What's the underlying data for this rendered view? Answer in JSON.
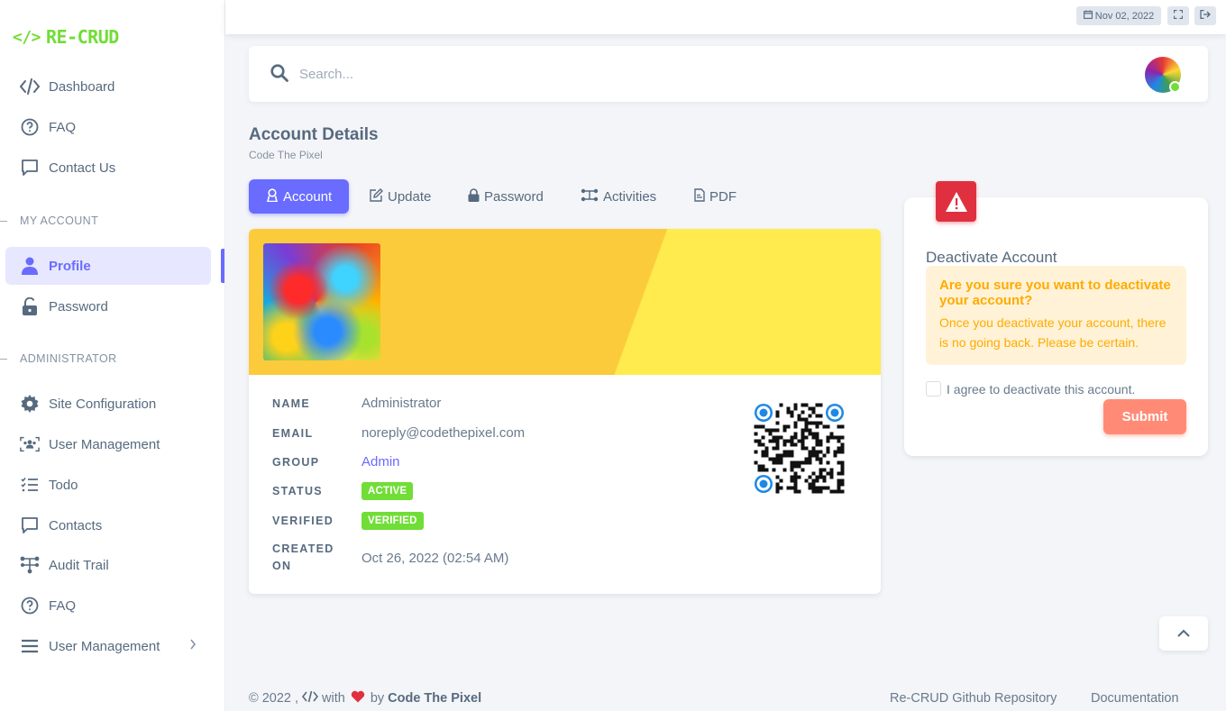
{
  "brand": {
    "name": "RE-CRUD",
    "logo_icon": "code-icon",
    "color": "#71dd37"
  },
  "sidebar": {
    "items_top": [
      {
        "label": "Dashboard",
        "icon": "code-icon"
      },
      {
        "label": "FAQ",
        "icon": "help-circle-icon"
      },
      {
        "label": "Contact Us",
        "icon": "chat-icon"
      }
    ],
    "section_account": "MY ACCOUNT",
    "items_account": [
      {
        "label": "Profile",
        "icon": "user-icon",
        "active": true
      },
      {
        "label": "Password",
        "icon": "lock-open-icon"
      }
    ],
    "section_admin": "ADMINISTRATOR",
    "items_admin": [
      {
        "label": "Site Configuration",
        "icon": "gear-icon"
      },
      {
        "label": "User Management",
        "icon": "users-icon"
      },
      {
        "label": "Todo",
        "icon": "checklist-icon"
      },
      {
        "label": "Contacts",
        "icon": "chat-icon"
      },
      {
        "label": "Audit Trail",
        "icon": "sitemap-icon"
      },
      {
        "label": "FAQ",
        "icon": "help-circle-icon"
      },
      {
        "label": "User Management",
        "icon": "menu-icon",
        "has_submenu": true
      }
    ]
  },
  "topbar": {
    "date": "Nov 02, 2022",
    "fullscreen_icon": "expand-icon",
    "logout_icon": "logout-icon"
  },
  "search": {
    "placeholder": "Search..."
  },
  "page": {
    "title": "Account Details",
    "subtitle": "Code The Pixel"
  },
  "tabs": [
    {
      "label": "Account",
      "icon": "user-badge-icon",
      "active": true
    },
    {
      "label": "Update",
      "icon": "edit-icon"
    },
    {
      "label": "Password",
      "icon": "lock-icon"
    },
    {
      "label": "Activities",
      "icon": "network-icon"
    },
    {
      "label": "PDF",
      "icon": "pdf-file-icon"
    }
  ],
  "profile": {
    "fields": [
      {
        "label": "NAME",
        "value": "Administrator"
      },
      {
        "label": "EMAIL",
        "value": "noreply@codethepixel.com"
      },
      {
        "label": "GROUP",
        "value": "Admin"
      },
      {
        "label": "STATUS",
        "value": "ACTIVE"
      },
      {
        "label": "VERIFIED",
        "value": "VERIFIED"
      },
      {
        "label": "CREATED",
        "label2": "ON",
        "value": "Oct 26, 2022 (02:54 AM)"
      }
    ]
  },
  "deactivate": {
    "title": "Deactivate Account",
    "alert_heading": "Are you sure you want to deactivate your account?",
    "alert_body": "Once you deactivate your account, there is no going back. Please be certain.",
    "agree_label": "I agree to deactivate this account.",
    "submit_label": "Submit",
    "colors": {
      "danger": "#e0303f",
      "warning": "#ffab00",
      "submit": "#ff8b77"
    }
  },
  "footer": {
    "copyright": "© 2022 ,",
    "with": "with",
    "by": "by",
    "author": "Code The Pixel",
    "links": [
      "Re-CRUD Github Repository",
      "Documentation"
    ]
  },
  "colors": {
    "primary": "#696cff",
    "success": "#71dd37"
  }
}
